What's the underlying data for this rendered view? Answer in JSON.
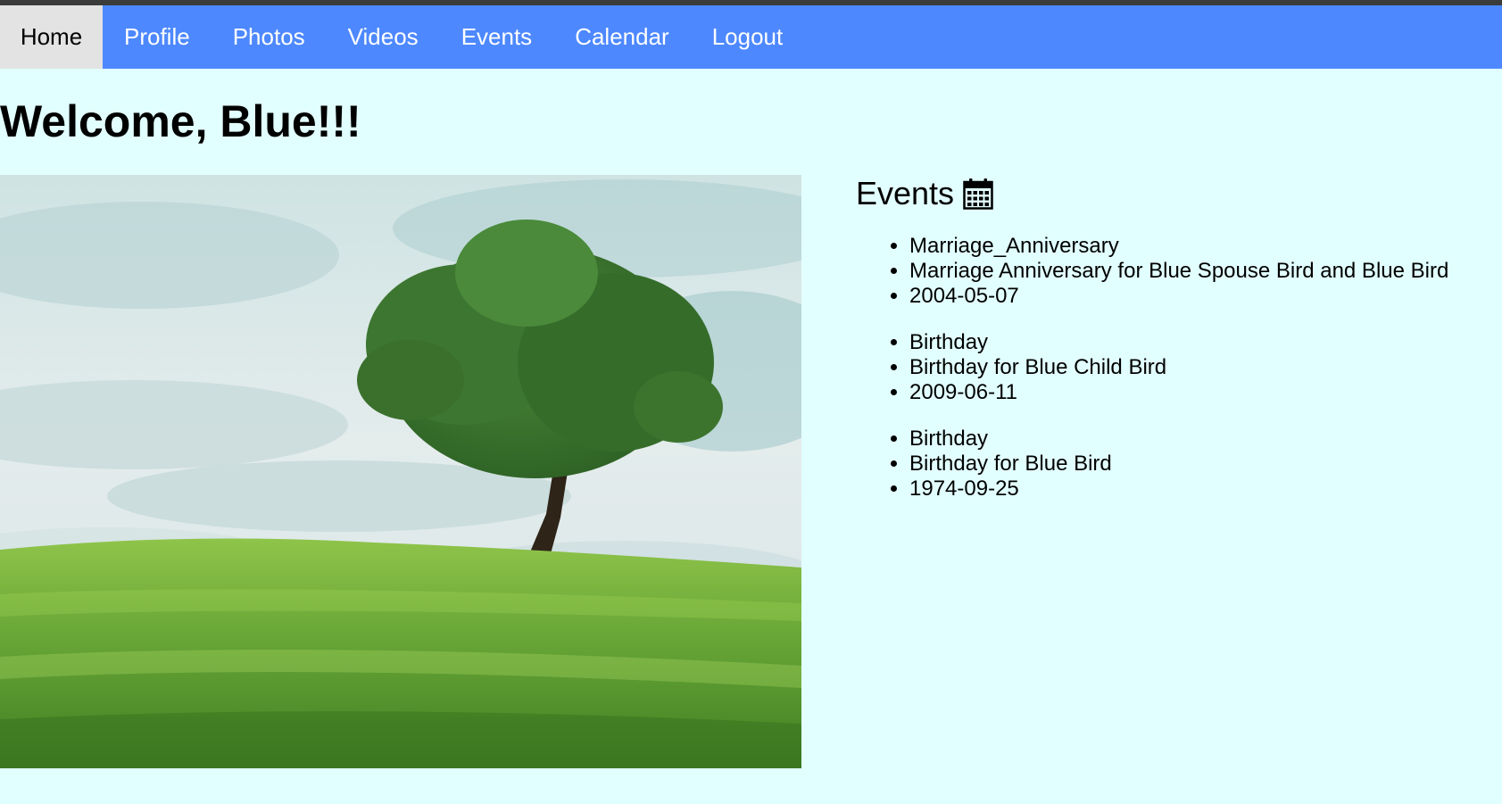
{
  "nav": {
    "items": [
      {
        "label": "Home",
        "active": true
      },
      {
        "label": "Profile",
        "active": false
      },
      {
        "label": "Photos",
        "active": false
      },
      {
        "label": "Videos",
        "active": false
      },
      {
        "label": "Events",
        "active": false
      },
      {
        "label": "Calendar",
        "active": false
      },
      {
        "label": "Logout",
        "active": false
      }
    ]
  },
  "page": {
    "title": "Welcome, Blue!!!"
  },
  "hero": {
    "description": "landscape photo: lone tree on a grassy hill under a cloudy sky"
  },
  "events": {
    "heading": "Events",
    "icon": "calendar-icon",
    "groups": [
      {
        "name": "Marriage_Anniversary",
        "description": "Marriage Anniversary for Blue Spouse Bird and Blue Bird",
        "date": "2004-05-07"
      },
      {
        "name": "Birthday",
        "description": "Birthday for Blue Child Bird",
        "date": "2009-06-11"
      },
      {
        "name": "Birthday",
        "description": "Birthday for Blue Bird",
        "date": "1974-09-25"
      }
    ]
  },
  "colors": {
    "navbar": "#4d88ff",
    "active_tab": "#e3e3e3",
    "page_background": "#e2ffff"
  }
}
